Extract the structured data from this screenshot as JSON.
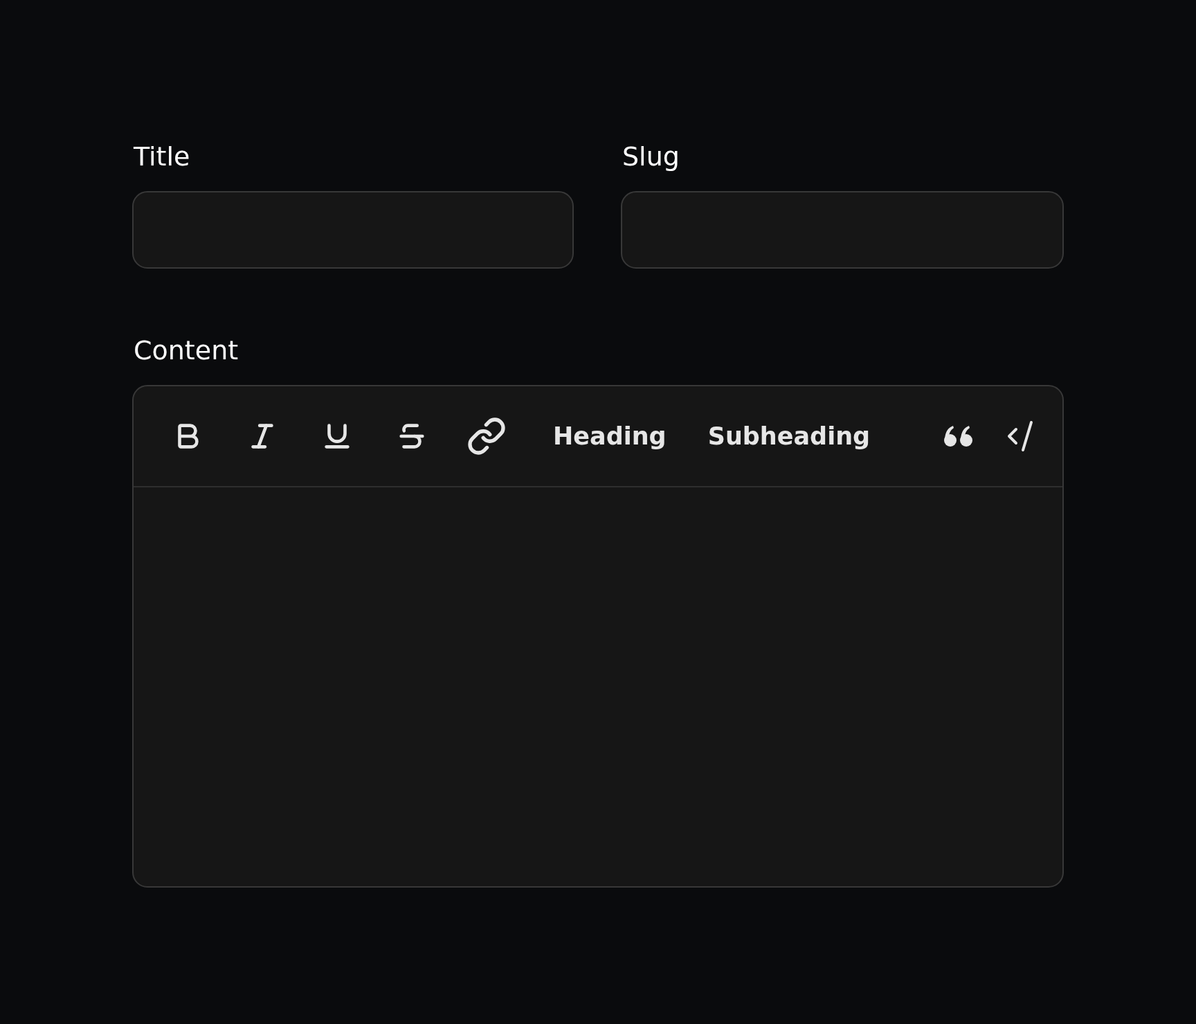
{
  "fields": [
    {
      "label": "Title"
    },
    {
      "label": "Slug"
    }
  ],
  "content": {
    "label": "Content",
    "toolbar_text_buttons": [
      "Heading",
      "Subheading"
    ]
  }
}
